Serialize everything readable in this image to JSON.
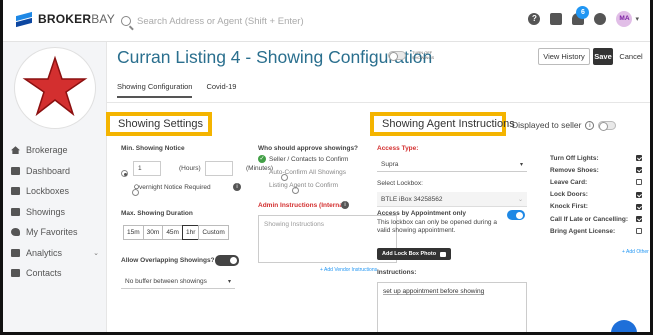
{
  "topbar": {
    "logo_bold": "BROKER",
    "logo_light": "BAY",
    "search_placeholder": "Search Address or Agent (Shift + Enter)",
    "notification_count": "6",
    "avatar_initials": "MA"
  },
  "sidebar": {
    "items": [
      {
        "label": "Brokerage"
      },
      {
        "label": "Dashboard"
      },
      {
        "label": "Lockboxes"
      },
      {
        "label": "Showings"
      },
      {
        "label": "My Favorites"
      },
      {
        "label": "Analytics"
      },
      {
        "label": "Contacts"
      }
    ]
  },
  "header": {
    "title": "Curran Listing 4 - Showing Configuration",
    "turn_off_label": "TURN OFF SHOWINGS",
    "view_history": "View History",
    "save": "Save",
    "cancel": "Cancel"
  },
  "tabs": [
    "Showing Configuration",
    "Covid-19"
  ],
  "showing_settings": {
    "header": "Showing Settings",
    "min_notice_label": "Min. Showing Notice",
    "hours_value": "1",
    "hours_unit": "(Hours)",
    "minutes_unit": "(Minutes)",
    "overnight_label": "Overnight Notice Required",
    "max_duration_label": "Max. Showing Duration",
    "durations": [
      "15m",
      "30m",
      "45m",
      "1hr",
      "Custom"
    ],
    "selected_duration": "1hr",
    "overlap_label": "Allow Overlapping Showings?",
    "buffer_value": "No buffer between showings"
  },
  "approval": {
    "label": "Who should approve showings?",
    "options": [
      "Seller / Contacts to Confirm",
      "Auto-Confirm All Showings",
      "Listing Agent to Confirm"
    ],
    "admin_label": "Admin Instructions (Internal)",
    "instructions_placeholder": "Showing Instructions",
    "add_vendor": "+ Add Vendor Instructions"
  },
  "agent_instructions": {
    "header": "Showing Agent Instructions",
    "displayed_label": "Displayed to seller",
    "access_type_label": "Access Type:",
    "access_type_value": "Supra",
    "select_lockbox_label": "Select Lockbox:",
    "lockbox_value": "BTLE iBox 34258562",
    "appt_label": "Access by Appointment only",
    "appt_desc": "This lockbox can only be opened during a valid showing appointment.",
    "add_photo": "Add Lock Box Photo",
    "instructions_label": "Instructions:",
    "instructions_value": "set up appointment before showing"
  },
  "checklist": {
    "items": [
      {
        "label": "Turn Off Lights:",
        "checked": true
      },
      {
        "label": "Remove Shoes:",
        "checked": true
      },
      {
        "label": "Leave Card:",
        "checked": false
      },
      {
        "label": "Lock Doors:",
        "checked": true
      },
      {
        "label": "Knock First:",
        "checked": true
      },
      {
        "label": "Call If Late or Cancelling:",
        "checked": true
      },
      {
        "label": "Bring Agent License:",
        "checked": false
      }
    ],
    "add_other": "+ Add Other"
  },
  "colors": {
    "accent": "#2a6f8e",
    "highlight": "#f4b400",
    "blue": "#1e88e5",
    "red": "#d32f2f"
  }
}
